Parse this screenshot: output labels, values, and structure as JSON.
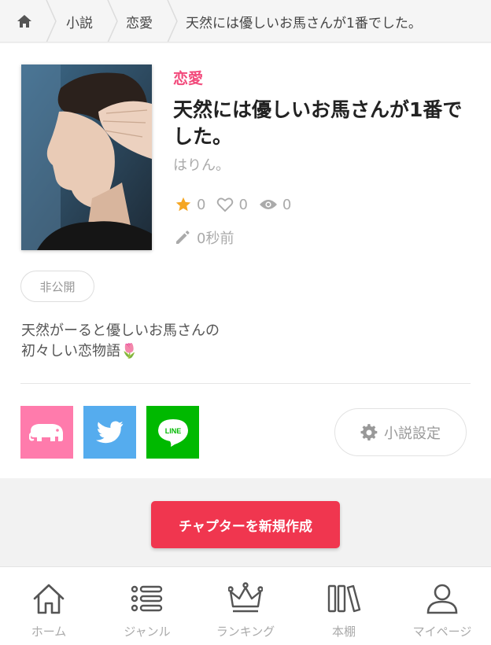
{
  "breadcrumb": {
    "home_icon": "home-icon",
    "items": [
      "小説",
      "恋愛",
      "天然には優しいお馬さんが1番でした。"
    ]
  },
  "novel": {
    "genre": "恋愛",
    "title": "天然には優しいお馬さんが1番でした。",
    "author": "はりん。",
    "stars": "0",
    "likes": "0",
    "views": "0",
    "updated": "0秒前",
    "status": "非公開",
    "description": "天然がーると優しいお馬さんの\n初々しい恋物語🌷"
  },
  "share": {
    "elephant_icon": "elephant-icon",
    "twitter_icon": "twitter-bird-icon",
    "line_label": "LINE"
  },
  "settings": {
    "label": "小説設定"
  },
  "cta": {
    "label": "チャプターを新規作成"
  },
  "nav": {
    "items": [
      {
        "label": "ホーム",
        "icon": "home-icon"
      },
      {
        "label": "ジャンル",
        "icon": "list-icon"
      },
      {
        "label": "ランキング",
        "icon": "crown-icon"
      },
      {
        "label": "本棚",
        "icon": "bookshelf-icon"
      },
      {
        "label": "マイページ",
        "icon": "user-icon"
      }
    ]
  },
  "colors": {
    "accent": "#f24b7c",
    "cta": "#f0364f",
    "elephant": "#ff7bac",
    "twitter": "#55acee",
    "line": "#00b900",
    "star": "#f5a623"
  }
}
